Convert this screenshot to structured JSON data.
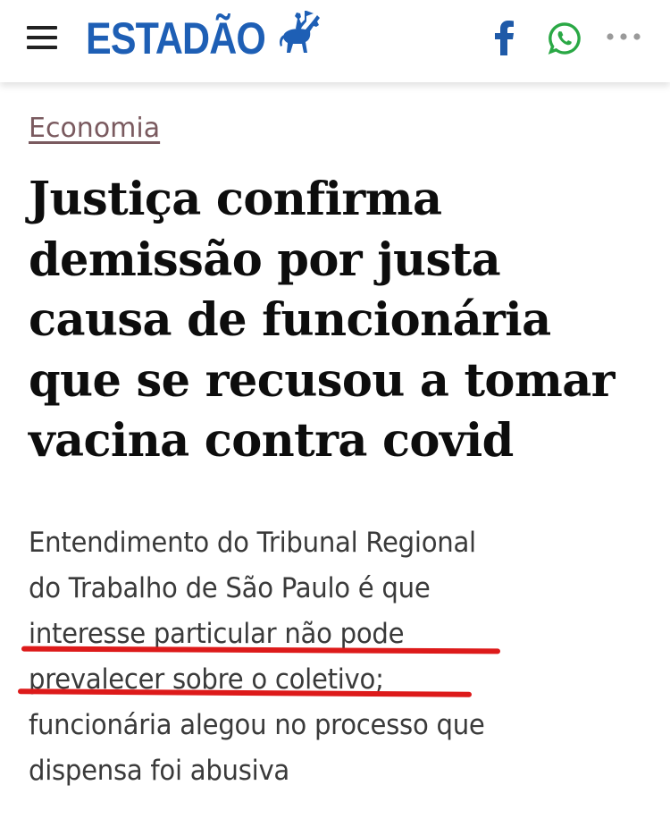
{
  "header": {
    "logo_text": "ESTADÃO",
    "menu_icon": "hamburger-menu-icon",
    "logo_icon": "horse-rider-logo-icon",
    "share_icons": [
      "facebook-icon",
      "whatsapp-icon",
      "more-options-icon"
    ]
  },
  "article": {
    "section": "Economia",
    "headline_lines": [
      "Justiça confirma",
      "demissão por justa",
      "causa de funcionária",
      "que se recusou a tomar",
      "vacina contra covid"
    ],
    "subhead_lines": [
      "Entendimento do Tribunal Regional",
      "do Trabalho de São Paulo é que",
      "interesse particular não pode",
      "prevalecer sobre o coletivo;",
      "funcionária alegou no processo que",
      "dispensa foi abusiva"
    ]
  },
  "colors": {
    "logo_blue": "#1e5fb5",
    "section_color": "#7a5a5f",
    "facebook_blue": "#1f5aa8",
    "whatsapp_green": "#2aa845",
    "highlight_red": "#dd1a1a"
  }
}
